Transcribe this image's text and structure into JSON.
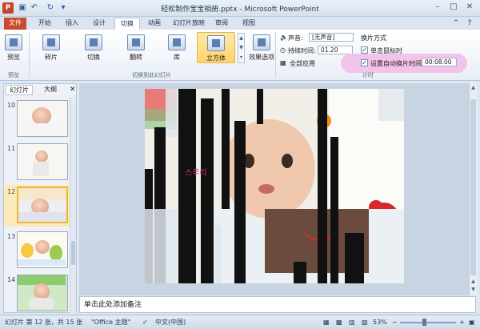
{
  "app": {
    "title": "轻松制作宝宝相册.pptx - Microsoft PowerPoint",
    "quick_access": [
      "save-icon",
      "undo-icon",
      "redo-icon",
      "customize-icon"
    ]
  },
  "tabs": [
    "文件",
    "开始",
    "插入",
    "设计",
    "切换",
    "动画",
    "幻灯片放映",
    "审阅",
    "视图"
  ],
  "ribbon": {
    "preview_label": "预览",
    "preview_group": "预览",
    "transitions": [
      "碎片",
      "切换",
      "翻转",
      "库",
      "立方体"
    ],
    "effect_options_label": "效果选项",
    "transition_group": "切换到此幻灯片",
    "sound_label": "声音:",
    "sound_value": "[无声音]",
    "duration_label": "持续时间:",
    "duration_value": "01.20",
    "apply_all_label": "全部应用",
    "switch_mode_label": "换片方式",
    "on_click_label": "单击鼠标时",
    "auto_label": "设置自动换片时间:",
    "auto_value": "00:08.00",
    "timing_group": "计时"
  },
  "panel": {
    "tabs": [
      "幻灯片",
      "大纲"
    ],
    "slide_numbers": [
      "10",
      "11",
      "12",
      "13",
      "14"
    ]
  },
  "notes_placeholder": "单击此处添加备注",
  "slide_overlay_text": "스루리",
  "status": {
    "slide_info": "幻灯片 第 12 张，共 15 张",
    "theme": "\"Office 主题\"",
    "language": "中文(中国)",
    "zoom": "53%"
  },
  "colors": {
    "file_tab": "#c94a2d",
    "highlight": "#f2c4ea",
    "selected": "#ffd36a"
  }
}
